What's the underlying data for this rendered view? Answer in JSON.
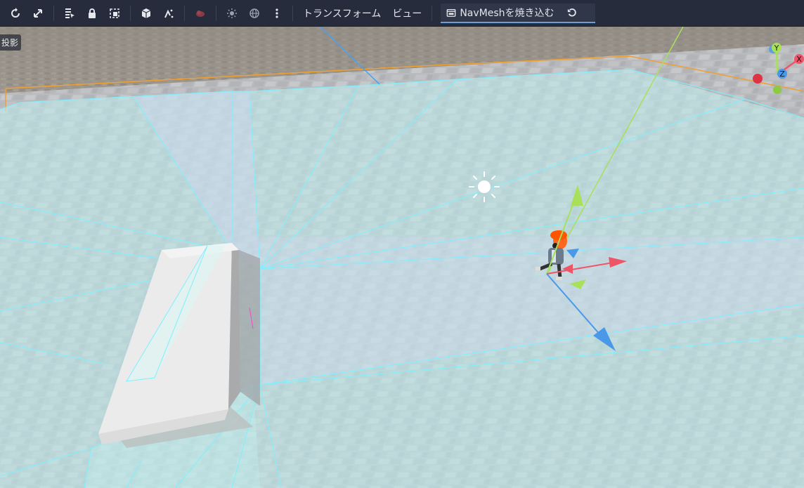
{
  "toolbar": {
    "transform_menu": "トランスフォーム",
    "view_menu": "ビュー",
    "bake_button": "NavMeshを焼き込む",
    "icons": [
      "rotate-icon",
      "scale-icon",
      "list-select-icon",
      "lock-icon",
      "group-icon",
      "cube-icon",
      "snap-icon",
      "environment-icon",
      "sun-icon",
      "globe-icon",
      "more-icon",
      "bake-icon",
      "revert-icon"
    ]
  },
  "viewport": {
    "projection_label": "投影",
    "gizmo": {
      "x_label": "X",
      "y_label": "Y",
      "z_label": "Z"
    }
  },
  "colors": {
    "toolbar_bg": "#262c3b",
    "navmesh_edge": "#7fefff",
    "bounds_orange": "#f0a030",
    "axis_x": "#ee5566",
    "axis_y": "#a8e05a",
    "axis_z": "#4a98e8"
  }
}
